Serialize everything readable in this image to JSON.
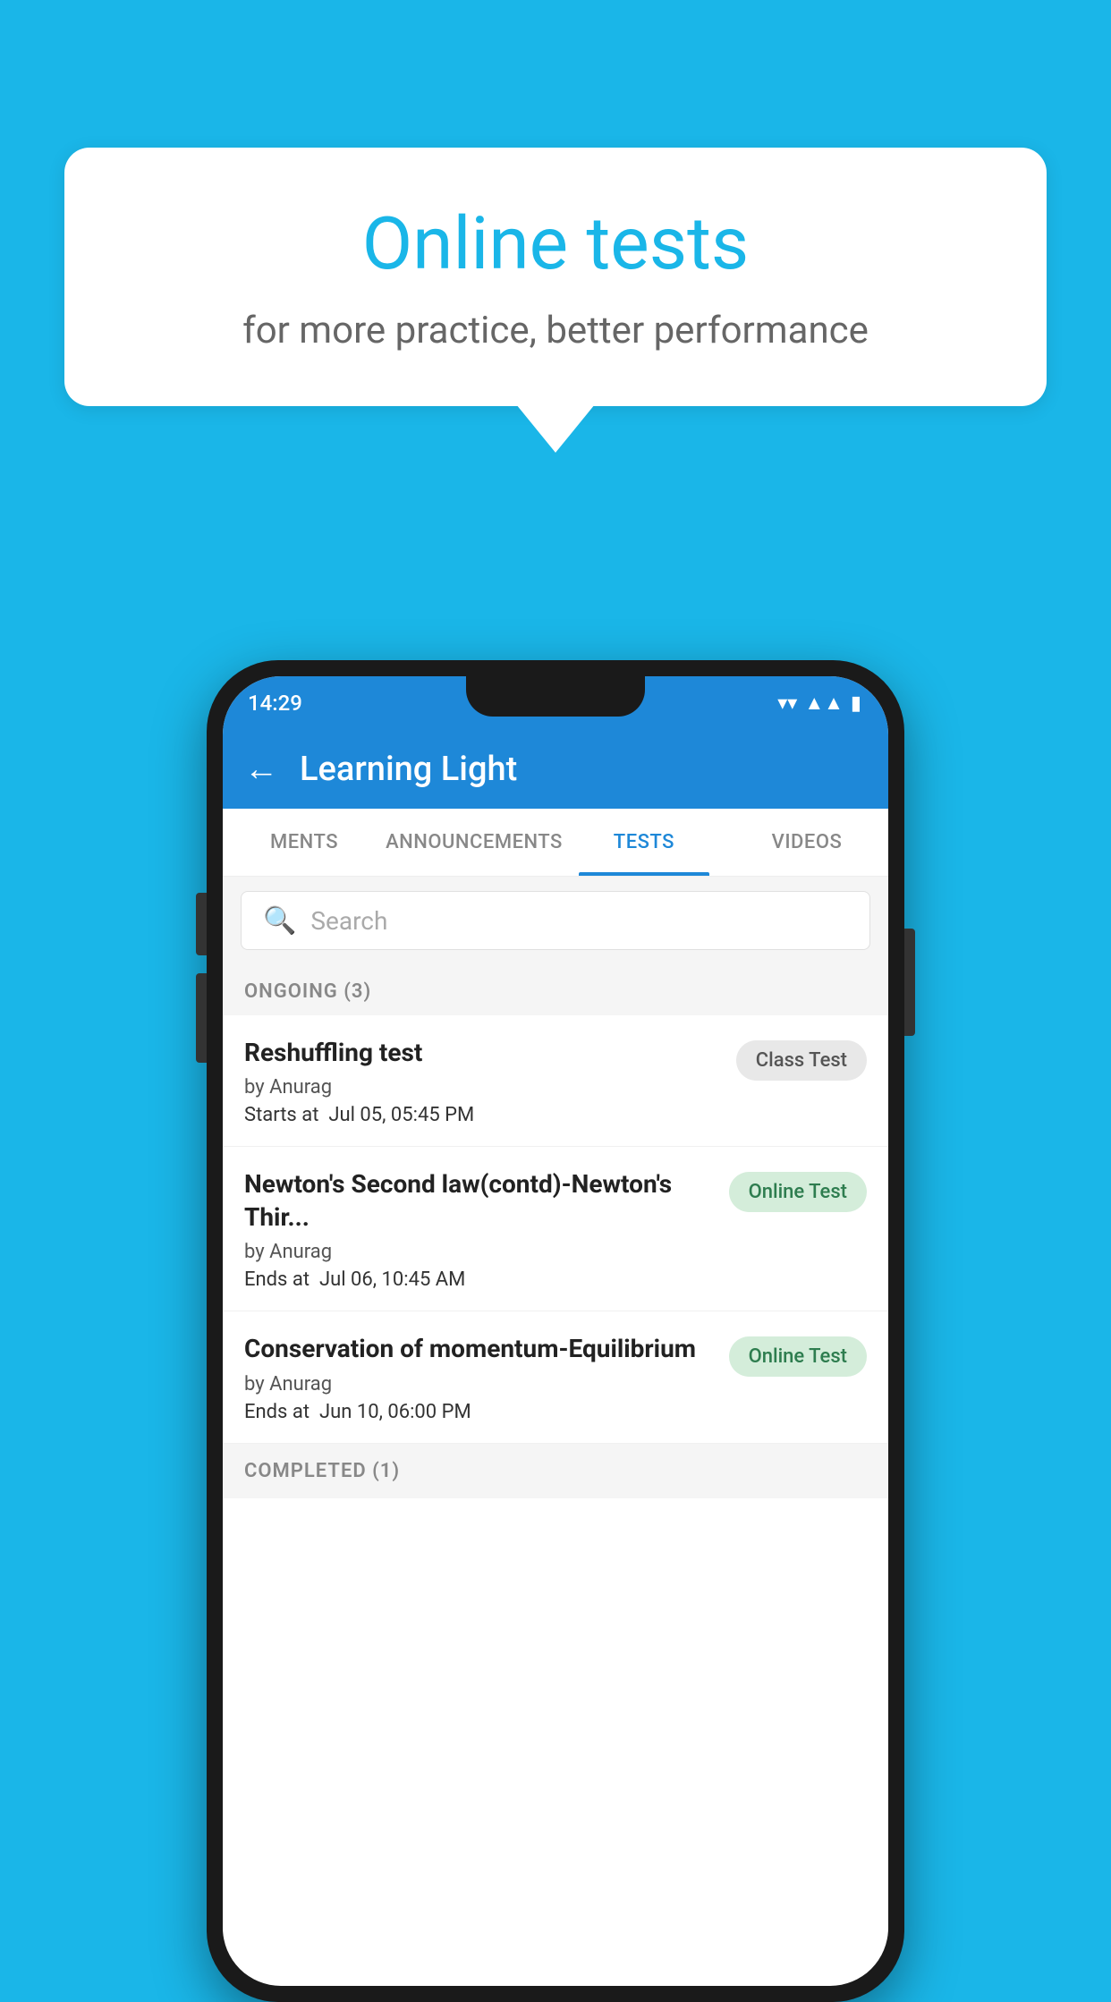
{
  "background": {
    "color": "#1ab6e8"
  },
  "speech_bubble": {
    "title": "Online tests",
    "subtitle": "for more practice, better performance"
  },
  "status_bar": {
    "time": "14:29",
    "wifi": "▾",
    "signal": "▾",
    "battery": "▮"
  },
  "app_bar": {
    "back_label": "←",
    "title": "Learning Light"
  },
  "tabs": [
    {
      "label": "MENTS",
      "active": false
    },
    {
      "label": "ANNOUNCEMENTS",
      "active": false
    },
    {
      "label": "TESTS",
      "active": true
    },
    {
      "label": "VIDEOS",
      "active": false
    }
  ],
  "search": {
    "placeholder": "Search"
  },
  "ongoing_section": {
    "label": "ONGOING (3)"
  },
  "tests": [
    {
      "name": "Reshuffling test",
      "author": "by Anurag",
      "time_label": "Starts at",
      "time_value": "Jul 05, 05:45 PM",
      "badge": "Class Test",
      "badge_type": "class"
    },
    {
      "name": "Newton's Second law(contd)-Newton's Thir...",
      "author": "by Anurag",
      "time_label": "Ends at",
      "time_value": "Jul 06, 10:45 AM",
      "badge": "Online Test",
      "badge_type": "online"
    },
    {
      "name": "Conservation of momentum-Equilibrium",
      "author": "by Anurag",
      "time_label": "Ends at",
      "time_value": "Jun 10, 06:00 PM",
      "badge": "Online Test",
      "badge_type": "online"
    }
  ],
  "completed_section": {
    "label": "COMPLETED (1)"
  }
}
